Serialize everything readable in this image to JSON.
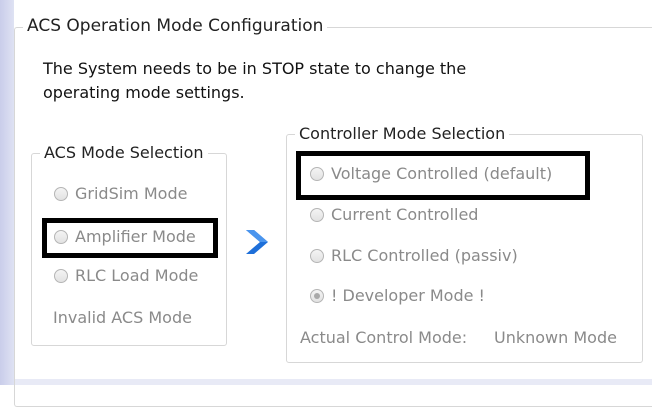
{
  "outer_group": {
    "title": "ACS Operation Mode Configuration"
  },
  "intro": {
    "line1": "The System needs to be in STOP state to change the",
    "line2": "operating mode settings."
  },
  "acs_mode": {
    "title": "ACS Mode Selection",
    "options": [
      {
        "label": "GridSim Mode",
        "checked": false
      },
      {
        "label": "Amplifier Mode",
        "checked": false
      },
      {
        "label": "RLC Load Mode",
        "checked": false
      }
    ],
    "status": "Invalid ACS Mode"
  },
  "controller_mode": {
    "title": "Controller Mode Selection",
    "options": [
      {
        "label": "Voltage Controlled (default)",
        "checked": false
      },
      {
        "label": "Current Controlled",
        "checked": false
      },
      {
        "label": "RLC Controlled (passiv)",
        "checked": false
      },
      {
        "label": "! Developer Mode !",
        "checked": true
      }
    ],
    "actual_label": "Actual Control Mode:",
    "actual_value": "Unknown Mode"
  },
  "colors": {
    "arrow": "#1e6fd9",
    "disabled_text": "#8a8a8a",
    "highlight": "#000000"
  },
  "icons": {
    "arrow": "chevron-right-icon"
  }
}
